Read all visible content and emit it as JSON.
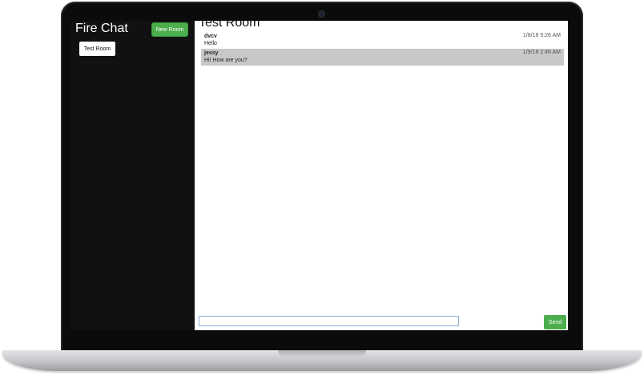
{
  "app": {
    "title": "Fire Chat"
  },
  "sidebar": {
    "new_room_label": "New Room",
    "rooms": [
      {
        "label": "Test Room"
      }
    ]
  },
  "room": {
    "title": "Test Room"
  },
  "messages": [
    {
      "user": "dvcv",
      "text": "Hello",
      "time": "1/8/18 5:26 AM",
      "highlighted": false
    },
    {
      "user": "jessy",
      "text": "Hi! How are you?",
      "time": "1/9/18 2:46 AM",
      "highlighted": true
    }
  ],
  "composer": {
    "value": "",
    "placeholder": "",
    "send_label": "Send"
  },
  "colors": {
    "sidebar": "#111111",
    "accent": "#4cae4c",
    "highlight": "#c8c8c8"
  }
}
